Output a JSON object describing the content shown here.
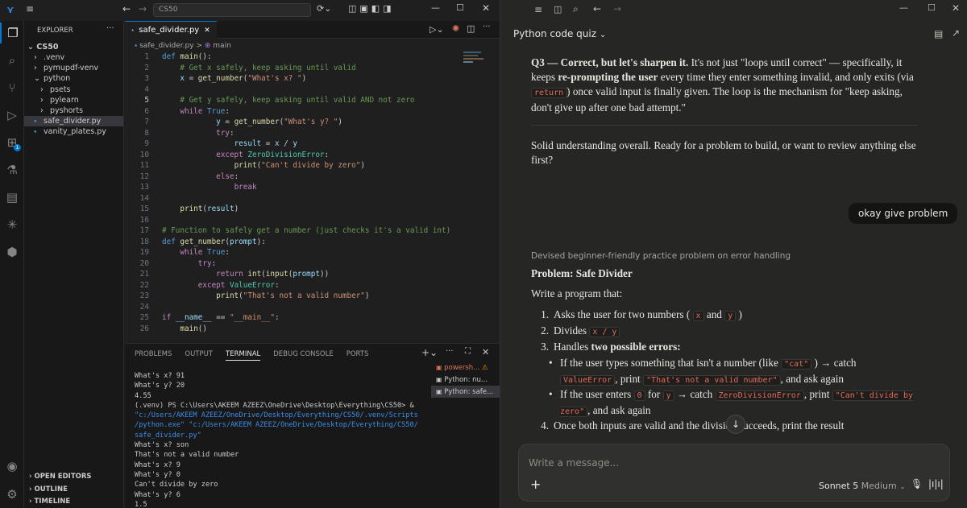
{
  "vscode": {
    "search": "CS50",
    "explorer_title": "EXPLORER",
    "root_folder": "CS50",
    "tree": [
      {
        "label": ".venv",
        "type": "folder",
        "depth": 1,
        "open": false
      },
      {
        "label": "pymupdf-venv",
        "type": "folder",
        "depth": 1,
        "open": false
      },
      {
        "label": "python",
        "type": "folder",
        "depth": 1,
        "open": true
      },
      {
        "label": "psets",
        "type": "folder",
        "depth": 2,
        "open": false
      },
      {
        "label": "pylearn",
        "type": "folder",
        "depth": 2,
        "open": false
      },
      {
        "label": "pyshorts",
        "type": "folder",
        "depth": 2,
        "open": false
      },
      {
        "label": "safe_divider.py",
        "type": "file",
        "depth": 1,
        "selected": true
      },
      {
        "label": "vanity_plates.py",
        "type": "file",
        "depth": 1
      }
    ],
    "bottom_sections": [
      "OPEN EDITORS",
      "OUTLINE",
      "TIMELINE"
    ],
    "tab_label": "safe_divider.py",
    "breadcrumb_file": "safe_divider.py",
    "breadcrumb_symbol": "main",
    "extensions_badge": "1",
    "code_lines": [
      "def main():",
      "    # Get x safely, keep asking until valid",
      "    x = get_number(\"What's x? \")",
      "",
      "    # Get y safely, keep asking until valid AND not zero",
      "    while True:",
      "            y = get_number(\"What's y? \")",
      "            try:",
      "                result = x / y",
      "            except ZeroDivisionError:",
      "                print(\"Can't divide by zero\")",
      "            else:",
      "                break",
      "",
      "    print(result)",
      "",
      "# Function to safely get a number (just checks it's a valid int)",
      "def get_number(prompt):",
      "    while True:",
      "        try:",
      "            return int(input(prompt))",
      "        except ValueError:",
      "            print(\"That's not a valid number\")",
      "",
      "if __name__ == \"__main__\":",
      "    main()"
    ],
    "panel_tabs": [
      "PROBLEMS",
      "OUTPUT",
      "TERMINAL",
      "DEBUG CONSOLE",
      "PORTS"
    ],
    "terminal_lines": [
      "What's x? 91",
      "What's y? 20",
      "4.55",
      "(.venv) PS C:\\Users\\AKEEM AZEEZ\\OneDrive\\Desktop\\Everything\\CS50> &",
      "\"c:/Users/AKEEM AZEEZ/OneDrive/Desktop/Everything/CS50/.venv/Scripts",
      "/python.exe\" \"c:/Users/AKEEM AZEEZ/OneDrive/Desktop/Everything/CS50/",
      "safe_divider.py\"",
      "What's x? son",
      "That's not a valid number",
      "What's x? 9",
      "What's y? 0",
      "Can't divide by zero",
      "What's y? 6",
      "1.5"
    ],
    "terminals": [
      "powersh...",
      "Python: nu...",
      "Python: safe..."
    ]
  },
  "claude": {
    "title": "Python code quiz",
    "q3_bold": "Q3 — Correct, but let's sharpen it.",
    "q3_text1": " It's not just \"loops until correct\" — specifically, it keeps ",
    "q3_bold2": "re-prompting the user",
    "q3_text2": " every time they enter something invalid, and only exits (via ",
    "q3_code": "return",
    "q3_text3": ") once valid input is finally given. The loop is the mechanism for \"keep asking, don't give up after one bad attempt.\"",
    "summary": "Solid understanding overall. Ready for a problem to build, or want to review anything else first?",
    "user_msg": "okay give problem",
    "thinking": "Devised beginner-friendly practice problem on error handling",
    "problem_title": "Problem: Safe Divider",
    "intro": "Write a program that:",
    "s1a": "Asks the user for two numbers (",
    "s1x": "x",
    "s1and": "and",
    "s1y": "y",
    "s1b": ")",
    "s2a": "Divides",
    "s2code": "x / y",
    "s3a": "Handles ",
    "s3b": "two possible errors:",
    "b1a": "If the user types something that isn't a number (like",
    "b1cat": "\"cat\"",
    "b1b": ") → catch",
    "b1err": "ValueError",
    "b1c": ", print",
    "b1msg": "\"That's not a valid number\"",
    "b1d": ", and ask again",
    "b2a": "If the user enters",
    "b2zero": "0",
    "b2for": "for",
    "b2y": "y",
    "b2b": "→ catch",
    "b2err": "ZeroDivisionError",
    "b2c": ", print",
    "b2msg": "\"Can't divide by zero\"",
    "b2d": ", and ask again",
    "s4": "Once both inputs are valid and the division succeeds, print the result",
    "input_placeholder": "Write a message...",
    "model": "Sonnet 5",
    "effort": "Medium"
  }
}
